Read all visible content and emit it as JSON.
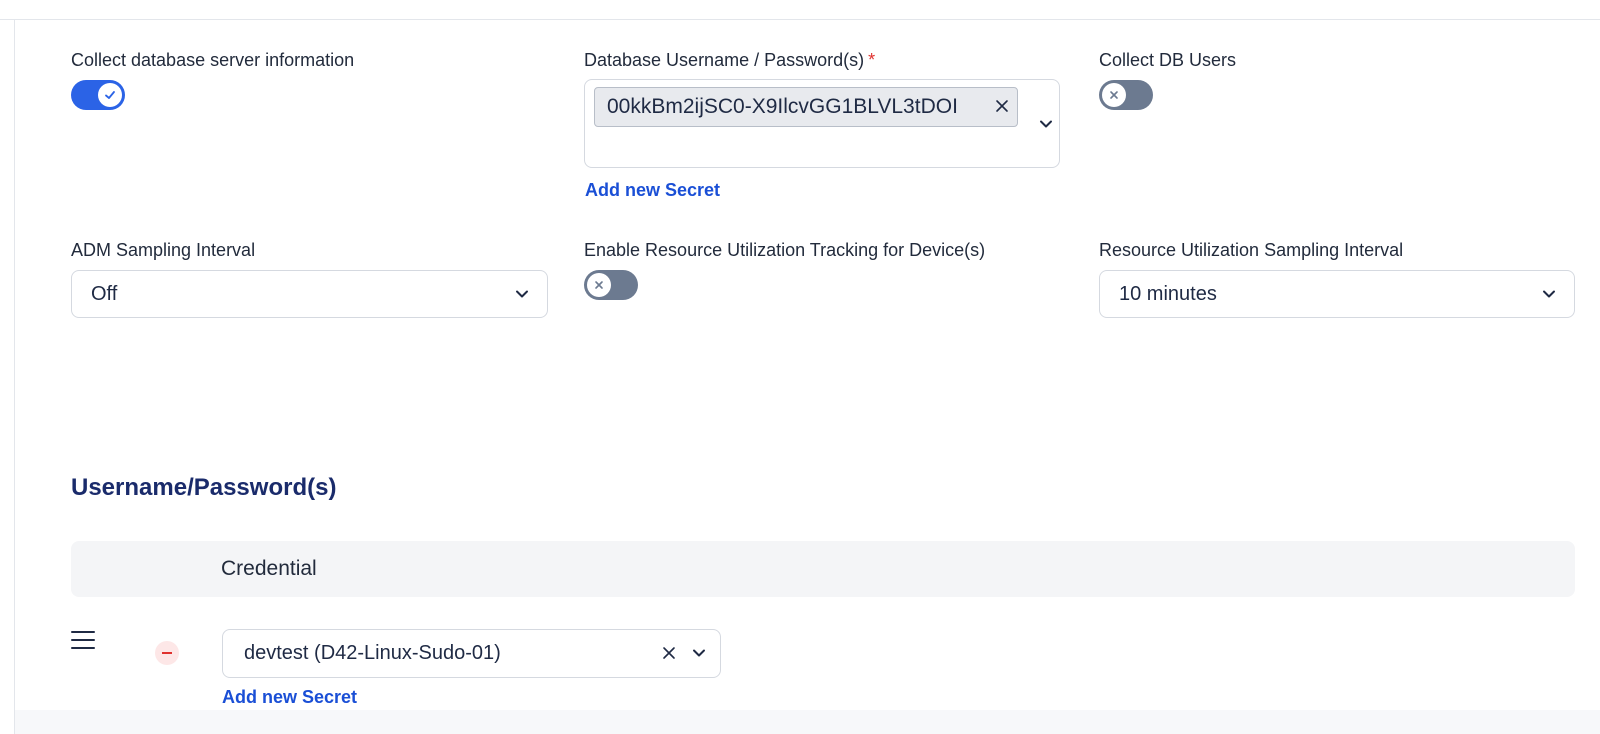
{
  "fields": {
    "collect_db_info": {
      "label": "Collect database server information",
      "enabled": true
    },
    "db_credentials": {
      "label": "Database Username / Password(s)",
      "required_mark": "*",
      "selected": [
        "00kkBm2ijSC0-X9IlcvGG1BLVL3tDOI"
      ],
      "add_secret_link": "Add new Secret"
    },
    "collect_db_users": {
      "label": "Collect DB Users",
      "enabled": false
    },
    "adm_sampling_interval": {
      "label": "ADM Sampling Interval",
      "value": "Off"
    },
    "resource_tracking": {
      "label": "Enable Resource Utilization Tracking for Device(s)",
      "enabled": false
    },
    "resource_sampling_interval": {
      "label": "Resource Utilization Sampling Interval",
      "value": "10 minutes"
    }
  },
  "credentials_section": {
    "title": "Username/Password(s)",
    "column_header": "Credential",
    "rows": [
      {
        "value": "devtest (D42-Linux-Sudo-01)",
        "add_secret_link": "Add new Secret"
      }
    ]
  },
  "icons": {
    "toggle_on": "check-icon",
    "toggle_off": "close-icon",
    "select": "chevron-down-icon",
    "drag": "drag-handle-icon",
    "remove": "minus-icon"
  },
  "colors": {
    "accent": "#2b63e6",
    "link": "#1a4fd6",
    "toggle_off": "#6c7a90",
    "required": "#e0312e",
    "section_title": "#1a2b6b"
  }
}
